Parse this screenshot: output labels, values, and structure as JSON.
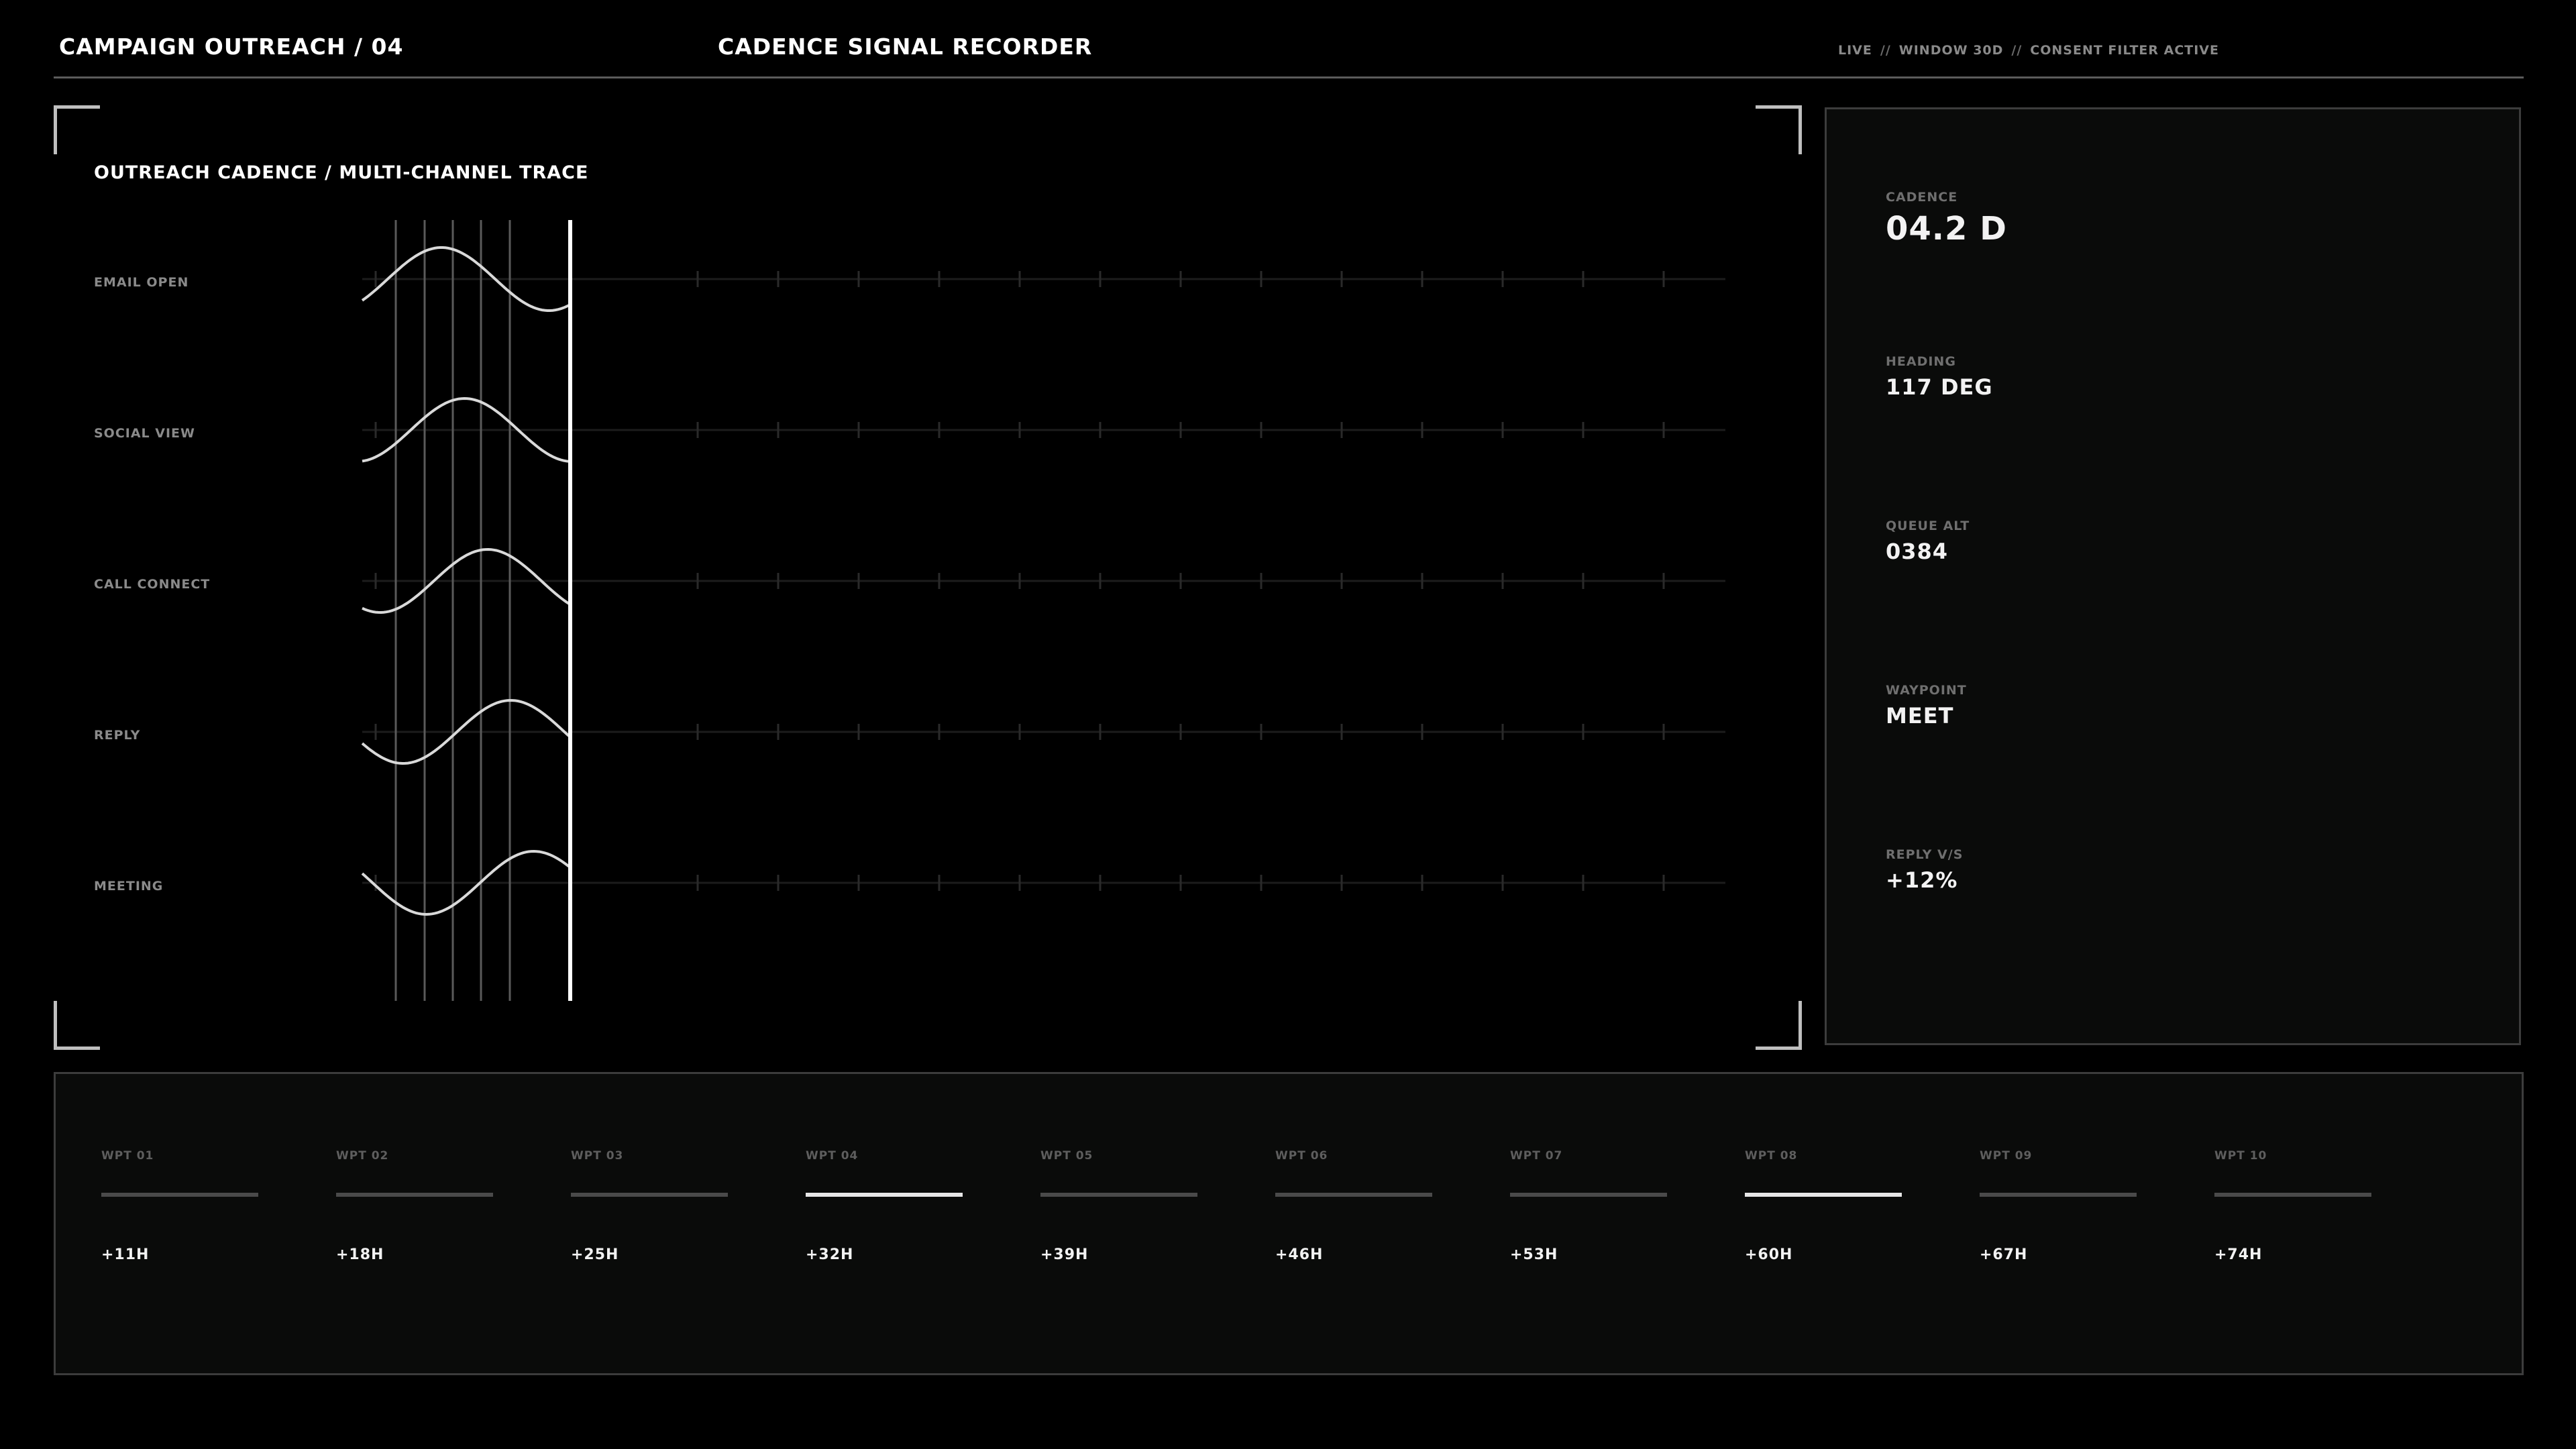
{
  "header": {
    "left_title": "CAMPAIGN OUTREACH / 04",
    "center_title": "CADENCE SIGNAL RECORDER",
    "status": [
      "LIVE",
      "WINDOW 30D",
      "CONSENT FILTER ACTIVE"
    ],
    "status_separator": "//"
  },
  "trace": {
    "title": "OUTREACH CADENCE / MULTI-CHANNEL TRACE",
    "channels": [
      {
        "label": "EMAIL OPEN",
        "phase": 0.55
      },
      {
        "label": "SOCIAL VIEW",
        "phase": 1.05
      },
      {
        "label": "CALL CONNECT",
        "phase": 1.55
      },
      {
        "label": "REPLY",
        "phase": 2.05
      },
      {
        "label": "MEETING",
        "phase": 2.55
      }
    ]
  },
  "readout": {
    "items": [
      {
        "label": "CADENCE",
        "value": "04.2 D"
      },
      {
        "label": "HEADING",
        "value": "117 DEG"
      },
      {
        "label": "QUEUE ALT",
        "value": "0384"
      },
      {
        "label": "WAYPOINT",
        "value": "MEET"
      },
      {
        "label": "REPLY V/S",
        "value": "+12%"
      }
    ]
  },
  "waypoints": [
    {
      "label": "WPT 01",
      "time": "+11H",
      "active": false
    },
    {
      "label": "WPT 02",
      "time": "+18H",
      "active": false
    },
    {
      "label": "WPT 03",
      "time": "+25H",
      "active": false
    },
    {
      "label": "WPT 04",
      "time": "+32H",
      "active": true
    },
    {
      "label": "WPT 05",
      "time": "+39H",
      "active": false
    },
    {
      "label": "WPT 06",
      "time": "+46H",
      "active": false
    },
    {
      "label": "WPT 07",
      "time": "+53H",
      "active": false
    },
    {
      "label": "WPT 08",
      "time": "+60H",
      "active": true
    },
    {
      "label": "WPT 09",
      "time": "+67H",
      "active": false
    },
    {
      "label": "WPT 10",
      "time": "+74H",
      "active": false
    }
  ],
  "colors": {
    "background": "#000000",
    "panel": "#0a0b0a",
    "accent": "#ffffff",
    "muted": "#8a8a8a"
  }
}
